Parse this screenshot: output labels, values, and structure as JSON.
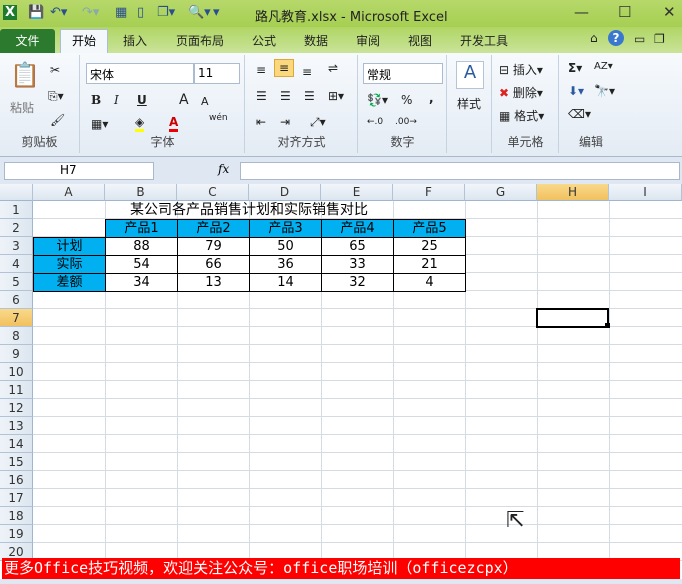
{
  "window": {
    "title": "路凡教育.xlsx - Microsoft Excel",
    "minimize": "—",
    "maximize": "☐",
    "close": "✕"
  },
  "tabs": [
    "文件",
    "开始",
    "插入",
    "页面布局",
    "公式",
    "数据",
    "审阅",
    "视图",
    "开发工具"
  ],
  "ribbon": {
    "clipboard": {
      "label": "剪贴板",
      "paste": "粘贴"
    },
    "font": {
      "label": "字体",
      "name": "宋体",
      "size": "11",
      "bold": "B",
      "italic": "I",
      "underline": "U",
      "grow": "A",
      "shrink": "A",
      "wen": "wén"
    },
    "alignment": {
      "label": "对齐方式"
    },
    "number": {
      "label": "数字",
      "format": "常规",
      "percent": "%",
      "comma": ","
    },
    "styles": {
      "label": "样式"
    },
    "cells": {
      "label": "单元格",
      "insert": "插入",
      "delete": "删除",
      "format": "格式"
    },
    "editing": {
      "label": "编辑",
      "sum": "Σ"
    }
  },
  "formula_bar": {
    "name_box": "H7",
    "fx": "fx",
    "value": ""
  },
  "columns": [
    "A",
    "B",
    "C",
    "D",
    "E",
    "F",
    "G",
    "H",
    "I"
  ],
  "rows": [
    "1",
    "2",
    "3",
    "4",
    "5",
    "6",
    "7",
    "8",
    "9",
    "10",
    "11",
    "12",
    "13",
    "14",
    "15",
    "16",
    "17",
    "18",
    "19",
    "20"
  ],
  "sheet": {
    "title": "某公司各产品销售计划和实际销售对比",
    "headers": [
      "产品1",
      "产品2",
      "产品3",
      "产品4",
      "产品5"
    ],
    "data": [
      {
        "label": "计划",
        "values": [
          "88",
          "79",
          "50",
          "65",
          "25"
        ]
      },
      {
        "label": "实际",
        "values": [
          "54",
          "66",
          "36",
          "33",
          "21"
        ]
      },
      {
        "label": "差额",
        "values": [
          "34",
          "13",
          "14",
          "32",
          "4"
        ]
      }
    ],
    "selected_cell": "H7",
    "header_fill": "#00b0f0"
  },
  "banner": "更多Office技巧视频，欢迎关注公众号：office职场培训（officezcpx）"
}
